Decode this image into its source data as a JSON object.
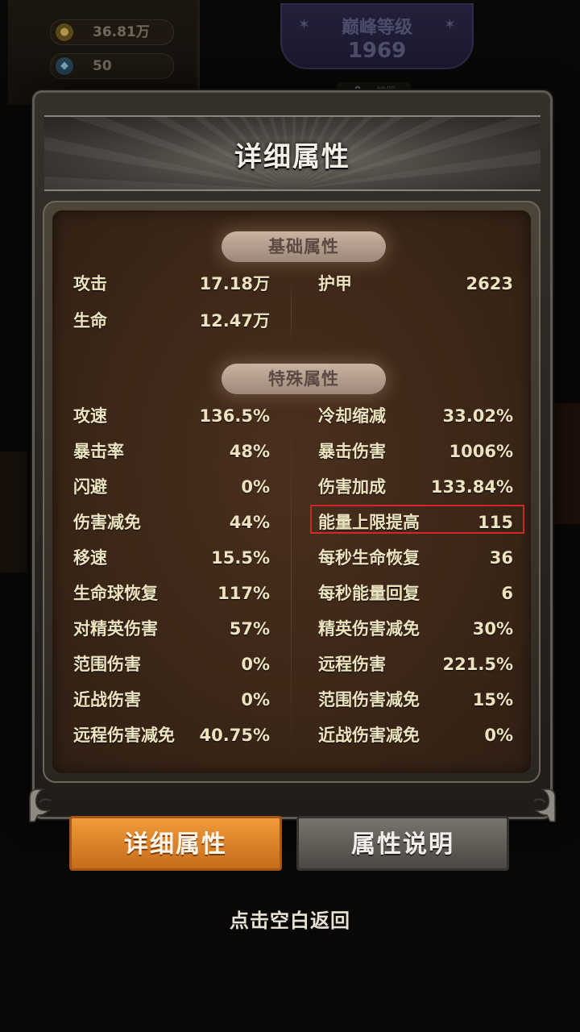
{
  "background": {
    "gold": "36.81万",
    "gems": "50",
    "peak_level_title": "巅峰等级",
    "peak_level_value": "1969",
    "lock_tag": "一神器"
  },
  "dialog": {
    "title": "详细属性",
    "sections": {
      "basic": "基础属性",
      "special": "特殊属性"
    },
    "basic_left": [
      {
        "label": "攻击",
        "value": "17.18万"
      },
      {
        "label": "生命",
        "value": "12.47万"
      }
    ],
    "basic_right": [
      {
        "label": "护甲",
        "value": "2623"
      }
    ],
    "special_left": [
      {
        "label": "攻速",
        "value": "136.5%"
      },
      {
        "label": "暴击率",
        "value": "48%"
      },
      {
        "label": "闪避",
        "value": "0%"
      },
      {
        "label": "伤害减免",
        "value": "44%"
      },
      {
        "label": "移速",
        "value": "15.5%"
      },
      {
        "label": "生命球恢复",
        "value": "117%"
      },
      {
        "label": "对精英伤害",
        "value": "57%"
      },
      {
        "label": "范围伤害",
        "value": "0%"
      },
      {
        "label": "近战伤害",
        "value": "0%"
      },
      {
        "label": "远程伤害减免",
        "value": "40.75%"
      }
    ],
    "special_right": [
      {
        "label": "冷却缩减",
        "value": "33.02%"
      },
      {
        "label": "暴击伤害",
        "value": "1006%"
      },
      {
        "label": "伤害加成",
        "value": "133.84%"
      },
      {
        "label": "能量上限提高",
        "value": "115"
      },
      {
        "label": "每秒生命恢复",
        "value": "36"
      },
      {
        "label": "每秒能量回复",
        "value": "6"
      },
      {
        "label": "精英伤害减免",
        "value": "30%"
      },
      {
        "label": "远程伤害",
        "value": "221.5%"
      },
      {
        "label": "范围伤害减免",
        "value": "15%"
      },
      {
        "label": "近战伤害减免",
        "value": "0%"
      }
    ]
  },
  "tabs": {
    "detail_label": "详细属性",
    "explain_label": "属性说明",
    "active": "详细属性"
  },
  "hint": "点击空白返回",
  "colors": {
    "stat_text": "#ede3bf",
    "active_tab": "#e08a2c",
    "inactive_tab": "#5f5b56",
    "highlight_box": "#d3252b"
  }
}
